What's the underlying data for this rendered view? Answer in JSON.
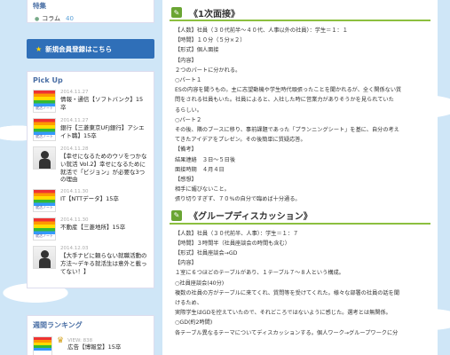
{
  "sidebar": {
    "category_head": "特集",
    "category": {
      "label": "コラム",
      "count": "40"
    },
    "signup_label": "新規会員登録はこちら",
    "pickup": {
      "title": "Pick Up",
      "posts": [
        {
          "date": "2014.11.27",
          "title": "情報・通信【ソフトバンク】15卒",
          "thumb": "stripe",
          "thumb_text": "就活ノート"
        },
        {
          "date": "2014.11.27",
          "title": "銀行【三菱東京UFJ銀行】アシエイト職】15卒",
          "thumb": "stripe",
          "thumb_text": "就活ノート"
        },
        {
          "date": "2014.11.28",
          "title": "【幸せになるためのウソをつかない就活 Vol.2】幸せになるために就活で「ビジョン」が必要な3つの理由",
          "thumb": "person",
          "thumb_text": ""
        },
        {
          "date": "2014.11.30",
          "title": "IT【NTTデータ】15卒",
          "thumb": "stripe",
          "thumb_text": "就活ノート"
        },
        {
          "date": "2014.11.30",
          "title": "不動産【三菱地所】15卒",
          "thumb": "stripe",
          "thumb_text": "就活ノート"
        },
        {
          "date": "2014.12.03",
          "title": "【大手ナビに頼らない就職活動の方法〜デキる就活生は意外と載ってない！】",
          "thumb": "person",
          "thumb_text": ""
        }
      ]
    },
    "ranking": {
      "title": "週間ランキング",
      "views": "VIEW: 838",
      "first": "広告【博報堂】15卒"
    }
  },
  "main": {
    "section1": {
      "title": "《1次面接》",
      "lines": [
        "【人数】社員（３０代前半〜４０代、人事以外の社員）：学生＝１：１",
        "【時間】１０分（５分×２）",
        "【形式】個人面接",
        "【内容】",
        "２つのパートに分かれる。",
        "○パート１",
        "ESの内容を聞うもの。主に志望動機や学生時代頑張ったことを聞かれるが、全く関係ない質",
        "問をされる社員もいた。社員によると、入社した時に営業力がありそうかを見られていた",
        "るらしい。",
        "○パート２",
        "その後、隣のブースに移り、事前課題であった「プランニングシート」を基に、自分の考え",
        "てきたアイデアをプレゼン。その後簡単に質疑応答。",
        "【備考】",
        "結果連絡　３日〜５日後",
        "面接時期　４月４日",
        "【感想】",
        "相手に媚びないこと。",
        "張り切りすぎず、７０%の自分で臨めば十分通る。"
      ]
    },
    "section2": {
      "title": "《グループディスカッション》",
      "lines": [
        "【人数】社員（３０代前半、人事）：学生＝１：７",
        "【時間】３時間半（社員座談会の時間も含む）",
        "【形式】社員座談会→GD",
        "【内容】",
        "１室に６つほどのテーブルがあり、１テーブル７〜８人という構成。",
        "○社員座談会(40分)",
        "複数の社員の方がテーブルに来てくれ、質問等を受けてくれた。様々な部署の社員の話を聞",
        "けるため、",
        "実際学生はGDを控えていたので、それどころではないように感じた。選考とは無関係。",
        "○GD(約2時間)",
        "各テーブル異なるテーマについてディスカッションする。個人ワーク→グループワークに分"
      ]
    }
  }
}
